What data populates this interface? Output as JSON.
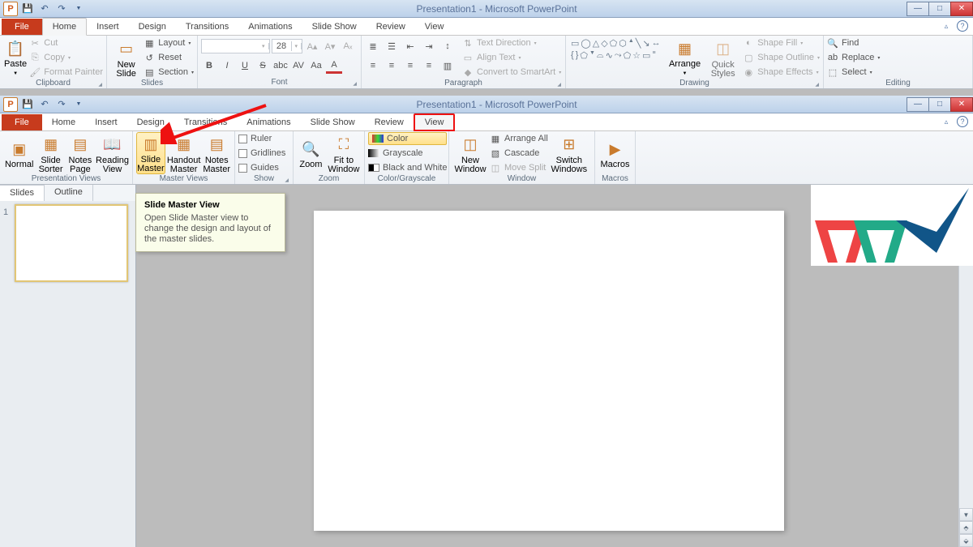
{
  "app_title": "Presentation1 - Microsoft PowerPoint",
  "top": {
    "tabs": {
      "file": "File",
      "home": "Home",
      "insert": "Insert",
      "design": "Design",
      "transitions": "Transitions",
      "animations": "Animations",
      "slide_show": "Slide Show",
      "review": "Review",
      "view": "View"
    },
    "clipboard": {
      "paste": "Paste",
      "cut": "Cut",
      "copy": "Copy",
      "format_painter": "Format Painter",
      "label": "Clipboard"
    },
    "slides": {
      "new_slide": "New\nSlide",
      "layout": "Layout",
      "reset": "Reset",
      "section": "Section",
      "label": "Slides"
    },
    "font": {
      "size": "28",
      "label": "Font"
    },
    "paragraph": {
      "text_direction": "Text Direction",
      "align_text": "Align Text",
      "convert": "Convert to SmartArt",
      "label": "Paragraph"
    },
    "drawing": {
      "arrange": "Arrange",
      "quick_styles": "Quick\nStyles",
      "shape_fill": "Shape Fill",
      "shape_outline": "Shape Outline",
      "shape_effects": "Shape Effects",
      "label": "Drawing"
    },
    "editing": {
      "find": "Find",
      "replace": "Replace",
      "select": "Select",
      "label": "Editing"
    }
  },
  "bottom": {
    "tabs": {
      "file": "File",
      "home": "Home",
      "insert": "Insert",
      "design": "Design",
      "transitions": "Transitions",
      "animations": "Animations",
      "slide_show": "Slide Show",
      "review": "Review",
      "view": "View"
    },
    "pres_views": {
      "normal": "Normal",
      "sorter": "Slide\nSorter",
      "notes": "Notes\nPage",
      "reading": "Reading\nView",
      "label": "Presentation Views"
    },
    "master_views": {
      "slide": "Slide\nMaster",
      "handout": "Handout\nMaster",
      "notes": "Notes\nMaster",
      "label": "Master Views"
    },
    "show": {
      "ruler": "Ruler",
      "gridlines": "Gridlines",
      "guides": "Guides",
      "label": "Show"
    },
    "zoom": {
      "zoom": "Zoom",
      "fit": "Fit to\nWindow",
      "label": "Zoom"
    },
    "color": {
      "color": "Color",
      "grayscale": "Grayscale",
      "bw": "Black and White",
      "label": "Color/Grayscale"
    },
    "window": {
      "new": "New\nWindow",
      "arrange": "Arrange All",
      "cascade": "Cascade",
      "split": "Move Split",
      "switch": "Switch\nWindows",
      "label": "Window"
    },
    "macros": {
      "macros": "Macros",
      "label": "Macros"
    }
  },
  "left_tabs": {
    "slides": "Slides",
    "outline": "Outline"
  },
  "thumb_number": "1",
  "tooltip": {
    "title": "Slide Master View",
    "body": "Open Slide Master view to change the design and layout of the master slides."
  }
}
